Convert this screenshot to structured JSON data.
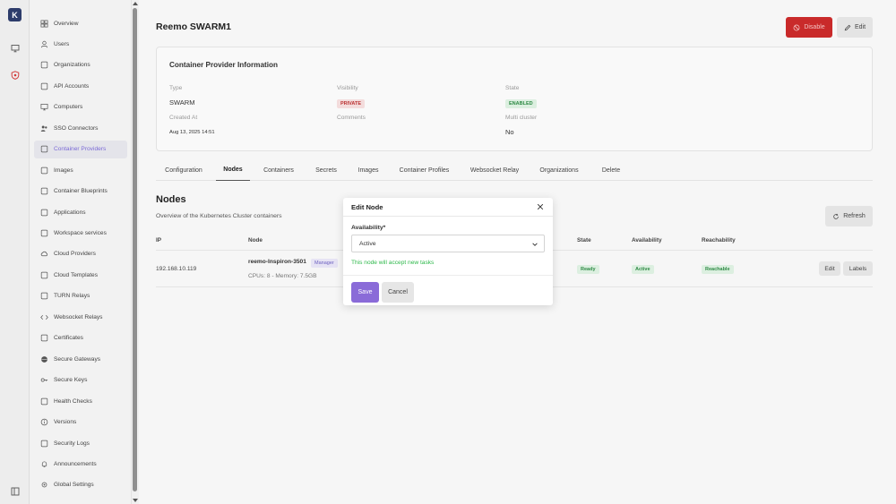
{
  "rail": {
    "logo_text": "K",
    "items": [
      {
        "name": "monitor-icon"
      },
      {
        "name": "shield-icon"
      },
      {
        "name": "sidebar-toggle-icon"
      }
    ]
  },
  "sidebar": {
    "items": [
      {
        "label": "Overview",
        "icon": "grid-icon"
      },
      {
        "label": "Users",
        "icon": "user-icon"
      },
      {
        "label": "Organizations",
        "icon": "building-icon"
      },
      {
        "label": "API Accounts",
        "icon": "api-icon"
      },
      {
        "label": "Computers",
        "icon": "monitor-icon"
      },
      {
        "label": "SSO Connectors",
        "icon": "users-icon"
      },
      {
        "label": "Container Providers",
        "icon": "server-icon",
        "active": true
      },
      {
        "label": "Images",
        "icon": "layers-icon"
      },
      {
        "label": "Container Blueprints",
        "icon": "blueprint-icon"
      },
      {
        "label": "Applications",
        "icon": "app-icon"
      },
      {
        "label": "Workspace services",
        "icon": "workspace-icon"
      },
      {
        "label": "Cloud Providers",
        "icon": "cloud-icon"
      },
      {
        "label": "Cloud Templates",
        "icon": "template-icon"
      },
      {
        "label": "TURN Relays",
        "icon": "relay-icon"
      },
      {
        "label": "Websocket Relays",
        "icon": "code-icon"
      },
      {
        "label": "Certificates",
        "icon": "certificate-icon"
      },
      {
        "label": "Secure Gateways",
        "icon": "globe-icon"
      },
      {
        "label": "Secure Keys",
        "icon": "key-icon"
      },
      {
        "label": "Health Checks",
        "icon": "health-icon"
      },
      {
        "label": "Versions",
        "icon": "info-icon"
      },
      {
        "label": "Security Logs",
        "icon": "shield-check-icon"
      },
      {
        "label": "Announcements",
        "icon": "bell-icon"
      },
      {
        "label": "Global Settings",
        "icon": "gear-icon"
      }
    ]
  },
  "header": {
    "title": "Reemo SWARM1",
    "disable_label": "Disable",
    "edit_label": "Edit"
  },
  "info": {
    "title": "Container Provider Information",
    "type_label": "Type",
    "type_value": "SWARM",
    "visibility_label": "Visibility",
    "visibility_value": "PRIVATE",
    "state_label": "State",
    "state_value": "ENABLED",
    "created_label": "Created At",
    "created_value": "Aug 13, 2025 14:51",
    "comments_label": "Comments",
    "multicluster_label": "Multi cluster",
    "multicluster_value": "No"
  },
  "tabs": [
    "Configuration",
    "Nodes",
    "Containers",
    "Secrets",
    "Images",
    "Container Profiles",
    "Websocket Relay",
    "Organizations",
    "Delete"
  ],
  "active_tab": "Nodes",
  "nodes": {
    "title": "Nodes",
    "subtitle": "Overview of the Kubernetes Cluster containers",
    "refresh_label": "Refresh",
    "columns": {
      "ip": "IP",
      "node": "Node",
      "state": "State",
      "availability": "Availability",
      "reachability": "Reachability"
    },
    "row": {
      "ip": "192.168.10.119",
      "node_name": "reemo-Inspiron-3501",
      "role": "Manager",
      "specs": "CPUs: 8 - Memory: 7.5GB",
      "state": "Ready",
      "availability": "Active",
      "reachability": "Reachable",
      "edit_label": "Edit",
      "labels_label": "Labels"
    }
  },
  "modal": {
    "title": "Edit Node",
    "field_label": "Availability*",
    "selected": "Active",
    "hint": "This node will accept new tasks",
    "save_label": "Save",
    "cancel_label": "Cancel"
  },
  "colors": {
    "accent": "#8a6bd8",
    "danger": "#c92a2a",
    "success": "#2db84a"
  }
}
